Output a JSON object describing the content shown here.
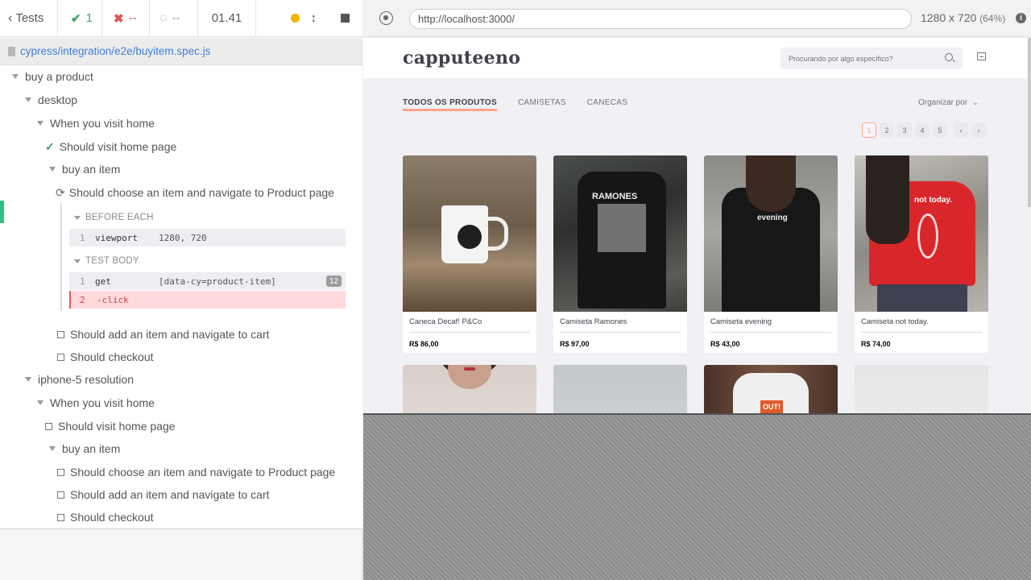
{
  "reporter": {
    "header": {
      "tests_label": "Tests",
      "passed": "1",
      "failed": "--",
      "pending": "--",
      "timer": "01.41"
    },
    "spec_path": "cypress/integration/e2e/buyitem.spec.js",
    "tree": [
      {
        "label": "buy a product",
        "type": "suite"
      },
      {
        "label": "desktop",
        "type": "suite"
      },
      {
        "label": "When you visit home",
        "type": "suite"
      },
      {
        "label": "Should visit home page",
        "type": "passed"
      },
      {
        "label": "buy an item",
        "type": "suite"
      },
      {
        "label": "Should choose an item and navigate to Product page",
        "type": "running"
      },
      {
        "label": "Should add an item and navigate to cart",
        "type": "pending"
      },
      {
        "label": "Should checkout",
        "type": "pending"
      },
      {
        "label": "iphone-5 resolution",
        "type": "suite"
      },
      {
        "label": "When you visit home",
        "type": "suite"
      },
      {
        "label": "Should visit home page",
        "type": "pending"
      },
      {
        "label": "buy an item",
        "type": "suite"
      },
      {
        "label": "Should choose an item and navigate to Product page",
        "type": "pending"
      },
      {
        "label": "Should add an item and navigate to cart",
        "type": "pending"
      },
      {
        "label": "Should checkout",
        "type": "pending"
      }
    ],
    "hooks": {
      "before_each": {
        "title": "BEFORE EACH",
        "commands": [
          {
            "num": "1",
            "name": "viewport",
            "message": "1280, 720"
          }
        ]
      },
      "test_body": {
        "title": "TEST BODY",
        "commands": [
          {
            "num": "1",
            "name": "get",
            "message": "[data-cy=product-item]",
            "badge": "12"
          },
          {
            "num": "2",
            "name": "-click",
            "message": ""
          }
        ]
      }
    }
  },
  "aut": {
    "url": "http://localhost:3000/",
    "viewport": "1280 x 720",
    "scale": "(64%)",
    "info_glyph": "i"
  },
  "site": {
    "logo": "capputeeno",
    "search_placeholder": "Procurando por algo específico?",
    "tabs": [
      "TODOS OS PRODUTOS",
      "CAMISETAS",
      "CANECAS"
    ],
    "order_by": "Organizar por",
    "pages": [
      "1",
      "2",
      "3",
      "4",
      "5"
    ],
    "prev": "‹",
    "next": "›",
    "products": [
      {
        "name": "Caneca Decaf! P&Co",
        "price": "R$ 86,00"
      },
      {
        "name": "Camiseta Ramones",
        "price": "R$ 97,00"
      },
      {
        "name": "Camiseta evening",
        "price": "R$ 43,00"
      },
      {
        "name": "Camiseta not today.",
        "price": "R$ 74,00"
      }
    ],
    "image_text": {
      "ramones": "RAMONES",
      "evening": "evening",
      "not_today": "not today.",
      "tag": "OUT!"
    }
  },
  "colors": {
    "pass": "#2fbf82",
    "fail": "#e0524f",
    "accent": "#ffa585",
    "link": "#3f7ed8"
  }
}
